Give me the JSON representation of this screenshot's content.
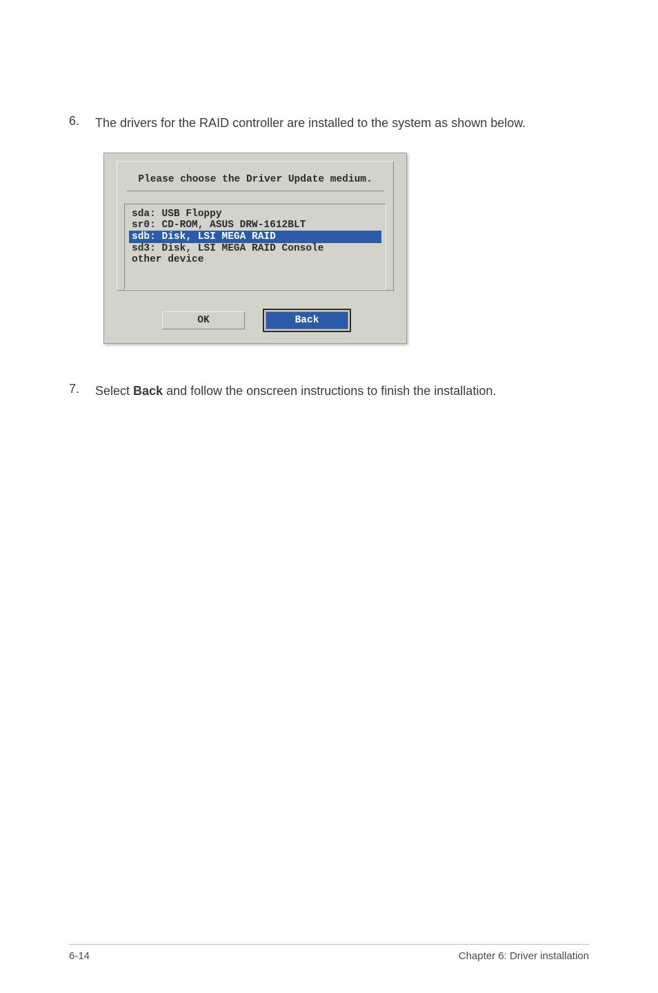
{
  "step6": {
    "num": "6.",
    "text": "The drivers for the RAID controller are installed to the system as shown below."
  },
  "dialog": {
    "title": "Please choose the Driver Update medium.",
    "items": [
      {
        "label": "sda: USB Floppy",
        "selected": false
      },
      {
        "label": "sr0: CD-ROM, ASUS DRW-1612BLT",
        "selected": false
      },
      {
        "label": "sdb: Disk, LSI MEGA RAID",
        "selected": true
      },
      {
        "label": "sd3: Disk, LSI MEGA RAID Console",
        "selected": false
      },
      {
        "label": "other device",
        "selected": false
      }
    ],
    "ok": "OK",
    "back": "Back"
  },
  "step7": {
    "num": "7.",
    "prefix": "Select ",
    "bold": "Back",
    "suffix": " and follow the onscreen instructions to finish the installation."
  },
  "footer": {
    "page": "6-14",
    "chapter": "Chapter 6: Driver installation"
  }
}
